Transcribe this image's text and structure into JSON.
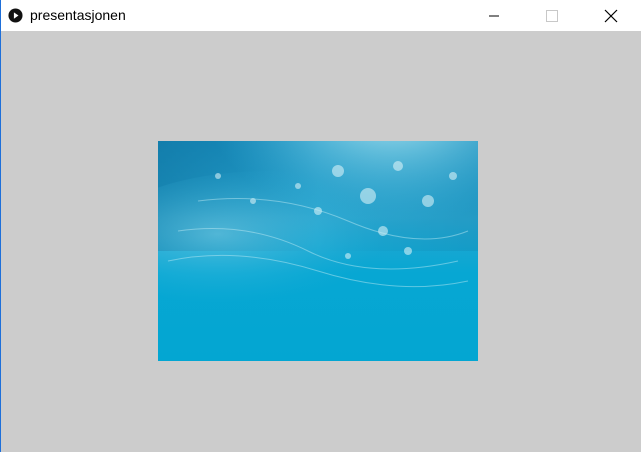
{
  "window": {
    "title": "presentasjonen",
    "app_icon": "play-circle-icon",
    "controls": [
      "minimize-icon",
      "maximize-icon",
      "close-icon"
    ]
  },
  "canvas": {
    "background": "#cccccc",
    "image": "underwater-water-surface"
  },
  "colors": {
    "water_deep": "#03a6d1",
    "water_top": "#1a8fbf",
    "foam": "#bfeaf3"
  }
}
